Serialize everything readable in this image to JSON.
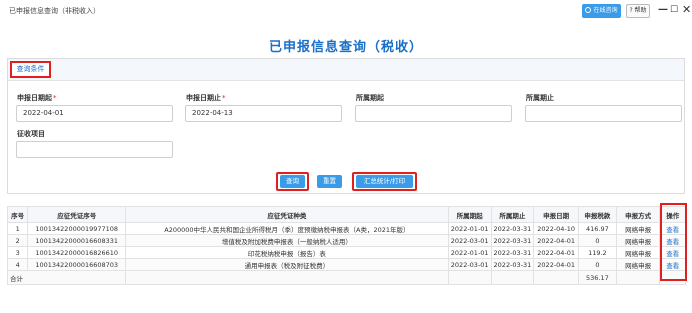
{
  "window": {
    "title": "已申报信息查询（非税收入）",
    "online_service": "在线咨询",
    "help": "? 帮助",
    "minimize": "—",
    "maximize": "☐",
    "close": "✕"
  },
  "page_title": "已申报信息查询（税收）",
  "query_panel": {
    "tab_label": "查询条件",
    "fields": {
      "apply_date_start": {
        "label": "申报日期起",
        "value": "2022-04-01",
        "required": true
      },
      "apply_date_end": {
        "label": "申报日期止",
        "value": "2022-04-13",
        "required": true
      },
      "period_start": {
        "label": "所属期起",
        "value": ""
      },
      "period_end": {
        "label": "所属期止",
        "value": ""
      },
      "tax_item": {
        "label": "征收项目",
        "value": ""
      }
    },
    "required_mark": "*",
    "buttons": {
      "query": "查询",
      "reset": "重置",
      "summary_print": "汇总统计/打印"
    }
  },
  "table": {
    "columns": [
      "序号",
      "应征凭证序号",
      "应征凭证种类",
      "所属期起",
      "所属期止",
      "申报日期",
      "申报税款",
      "申报方式",
      "操作"
    ],
    "rows": [
      [
        "1",
        "10013422000019977108",
        "A200000中华人民共和国企业所得税月（季）度预缴纳税申报表（A类，2021年版）",
        "2022-01-01",
        "2022-03-31",
        "2022-04-10",
        "416.97",
        "网络申报",
        "查看"
      ],
      [
        "2",
        "10013422000016608331",
        "增值税及附加税费申报表（一般纳税人适用）",
        "2022-03-01",
        "2022-03-31",
        "2022-04-01",
        "0",
        "网络申报",
        "查看"
      ],
      [
        "3",
        "10013422000016826610",
        "印花税纳税申报（报告）表",
        "2022-01-01",
        "2022-03-31",
        "2022-04-01",
        "119.2",
        "网络申报",
        "查看"
      ],
      [
        "4",
        "10013422000016608703",
        "通用申报表（税及附征税费）",
        "2022-03-01",
        "2022-03-31",
        "2022-04-01",
        "0",
        "网络申报",
        "查看"
      ]
    ],
    "summary_label": "合计",
    "summary_total": "536.17"
  },
  "colors": {
    "accent": "#1a6fc9",
    "highlight_border": "#e02020",
    "button_blue": "#3a9be8"
  }
}
